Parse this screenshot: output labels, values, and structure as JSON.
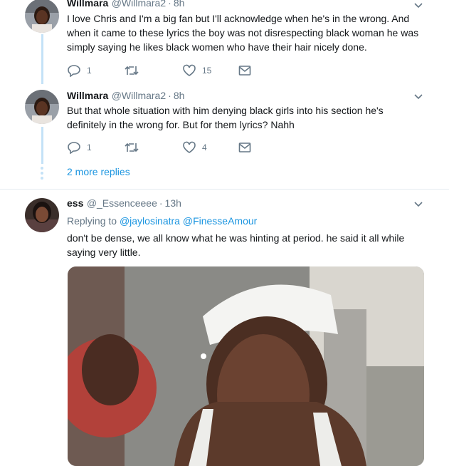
{
  "tweets": [
    {
      "name": "Willmara",
      "handle": "@Willmara2",
      "time": "8h",
      "text": "I love Chris and I'm a big fan but I'll acknowledge when he's in the wrong. And when it came to these lyrics the boy was not disrespecting black woman he was simply saying he likes black women who have their hair nicely done.",
      "replies": "1",
      "retweets": "",
      "likes": "15"
    },
    {
      "name": "Willmara",
      "handle": "@Willmara2",
      "time": "8h",
      "text": "But that whole situation with him denying black girls into his section he's definitely in the wrong for. But for them lyrics? Nahh",
      "replies": "1",
      "retweets": "",
      "likes": "4"
    },
    {
      "name": "ess",
      "handle": "@_Essenceeee",
      "time": "13h",
      "replying_label": "Replying to",
      "replying_to": [
        "@jaylosinatra",
        "@FinesseAmour"
      ],
      "text": "don't be dense, we all know what he was hinting at period. he said it all while saying very little."
    }
  ],
  "more_replies": "2 more replies",
  "icons": {
    "reply": "reply-icon",
    "retweet": "retweet-icon",
    "like": "heart-icon",
    "dm": "envelope-icon",
    "menu": "chevron-down-icon"
  },
  "colors": {
    "link": "#1b95e0",
    "secondary": "#657786",
    "thread_line": "#c4e2f7"
  }
}
